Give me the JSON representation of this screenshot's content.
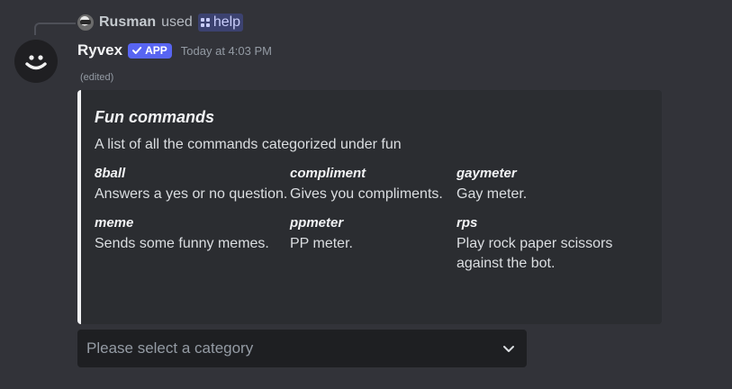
{
  "reply": {
    "user": "Rusman",
    "verb": "used",
    "command": "help"
  },
  "message": {
    "author": "Ryvex",
    "badge": "APP",
    "timestamp": "Today at 4:03 PM",
    "edited": "(edited)"
  },
  "embed": {
    "accent_color": "#f2f3f5",
    "title": "Fun commands",
    "description": "A list of all the commands categorized under fun",
    "fields": [
      {
        "name": "8ball",
        "value": "Answers a yes or no question."
      },
      {
        "name": "compliment",
        "value": "Gives you compliments."
      },
      {
        "name": "gaymeter",
        "value": "Gay meter."
      },
      {
        "name": "meme",
        "value": "Sends some funny memes."
      },
      {
        "name": "ppmeter",
        "value": "PP meter."
      },
      {
        "name": "rps",
        "value": "Play rock paper scissors against the bot."
      }
    ]
  },
  "select_menu": {
    "placeholder": "Please select a category",
    "icon": "chevron-down-icon"
  },
  "colors": {
    "background": "#323339",
    "embed_bg": "#2b2d31",
    "brand": "#5865f2"
  }
}
